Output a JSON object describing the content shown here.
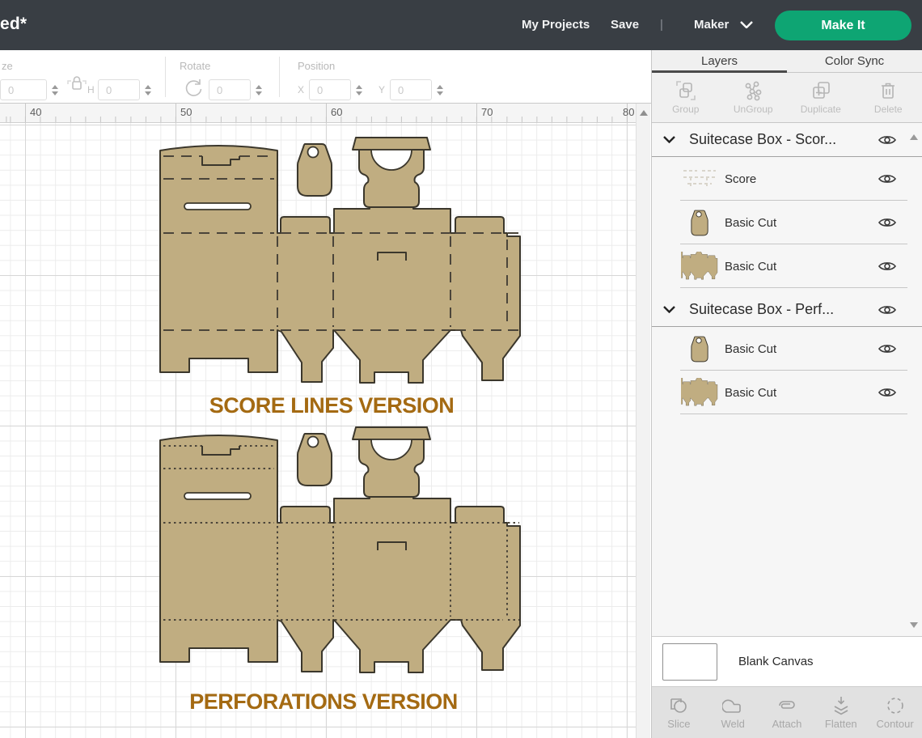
{
  "header": {
    "title": "ed*",
    "nav": [
      "My Projects",
      "Save"
    ],
    "divider": "|",
    "machine": "Maker",
    "make_button": "Make It"
  },
  "toolbar": {
    "size_label": "ze",
    "h_label": "H",
    "rotate_label": "Rotate",
    "position_label": "Position",
    "x_label": "X",
    "y_label": "Y",
    "size_w_value": "0",
    "size_h_value": "0",
    "rotate_value": "0",
    "x_value": "0",
    "y_value": "0"
  },
  "ruler": {
    "labels": [
      "40",
      "50",
      "60",
      "70",
      "80"
    ]
  },
  "canvas": {
    "score_caption": "SCORE LINES VERSION",
    "perforations_caption": "PERFORATIONS VERSION"
  },
  "layers_panel": {
    "tabs": [
      {
        "label": "Layers"
      },
      {
        "label": "Color Sync"
      }
    ],
    "actions": [
      {
        "label": "Group",
        "icon": "group-icon"
      },
      {
        "label": "UnGroup",
        "icon": "ungroup-icon"
      },
      {
        "label": "Duplicate",
        "icon": "duplicate-icon"
      },
      {
        "label": "Delete",
        "icon": "delete-icon"
      }
    ],
    "groups": [
      {
        "title": "Suitecase Box - Scor...",
        "items": [
          {
            "label": "Score",
            "thumb": "score-thumbnail"
          },
          {
            "label": "Basic Cut",
            "thumb": "tag-thumbnail"
          },
          {
            "label": "Basic Cut",
            "thumb": "box-thumbnail"
          }
        ]
      },
      {
        "title": "Suitecase Box - Perf...",
        "items": [
          {
            "label": "Basic Cut",
            "thumb": "tag-thumbnail"
          },
          {
            "label": "Basic Cut",
            "thumb": "box-thumbnail"
          }
        ]
      }
    ],
    "blank_canvas_label": "Blank Canvas",
    "bottom_actions": [
      "Slice",
      "Weld",
      "Attach",
      "Flatten",
      "Contour"
    ]
  },
  "colors": {
    "header_bg": "#393e44",
    "accent_green": "#0ea573",
    "material_tan": "#c0ad81",
    "caption_brown": "#a46a12",
    "outline_dark": "#3b372c"
  }
}
